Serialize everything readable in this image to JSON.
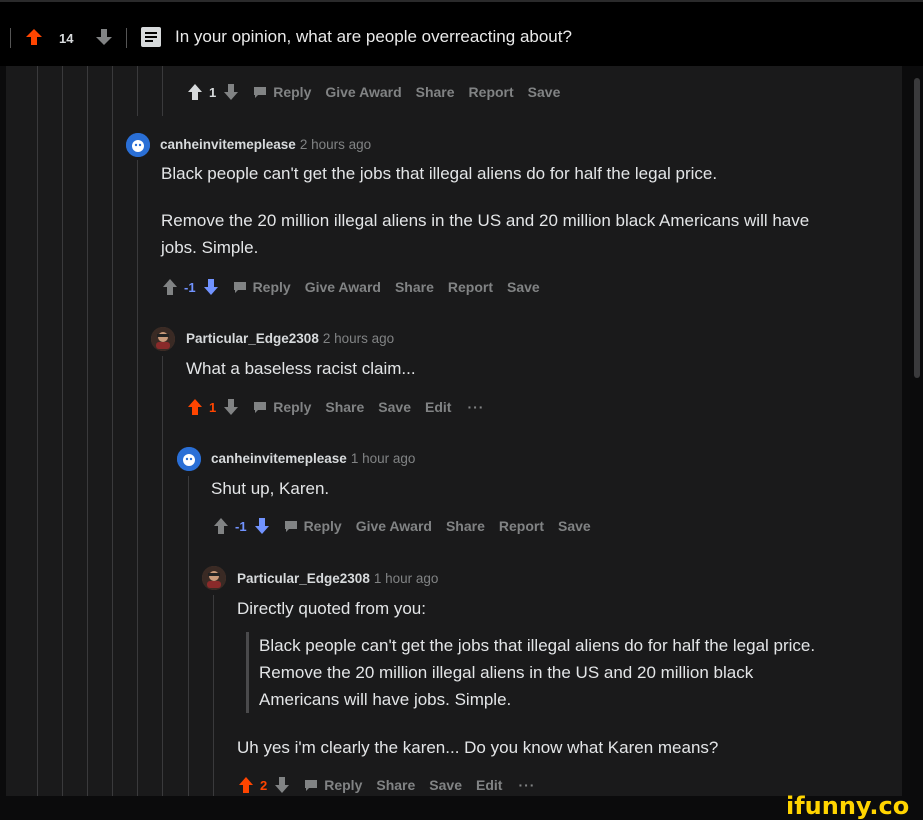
{
  "header": {
    "score": "14",
    "title": "In your opinion, what are people overreacting about?"
  },
  "actions": {
    "reply": "Reply",
    "give_award": "Give Award",
    "share": "Share",
    "report": "Report",
    "save": "Save",
    "edit": "Edit",
    "more": "···"
  },
  "comments": [
    {
      "score": "1"
    },
    {
      "user": "canheinvitemeplease",
      "time": "2 hours ago",
      "lines": [
        "Black people can't get the jobs that illegal aliens do for half the legal price.",
        "Remove the 20 million illegal aliens in the US and 20 million black Americans will have",
        "jobs. Simple."
      ],
      "score": "-1"
    },
    {
      "user": "Particular_Edge2308",
      "time": "2 hours ago",
      "lines": [
        "What a baseless racist claim..."
      ],
      "score": "1"
    },
    {
      "user": "canheinvitemeplease",
      "time": "1 hour ago",
      "lines": [
        "Shut up, Karen."
      ],
      "score": "-1"
    },
    {
      "user": "Particular_Edge2308",
      "time": "1 hour ago",
      "lines": [
        "Directly quoted from you:"
      ],
      "quote": [
        "Black people can't get the jobs that illegal aliens do for half the legal price.",
        "Remove the 20 million illegal aliens in the US and 20 million black",
        "Americans will have jobs. Simple."
      ],
      "reply_line": "Uh yes i'm clearly the karen... Do you know what Karen means?",
      "score": "2"
    }
  ],
  "watermark": "ifunny.co",
  "colors": {
    "upvote_active": "#ff4500",
    "downvote_active": "#7193ff",
    "muted": "#818384",
    "panel_bg": "#1a1a1b"
  },
  "icons": [
    "arrow-up-icon",
    "arrow-down-icon",
    "comment-icon",
    "post-icon",
    "ellipsis-icon",
    "avatar-icon"
  ]
}
